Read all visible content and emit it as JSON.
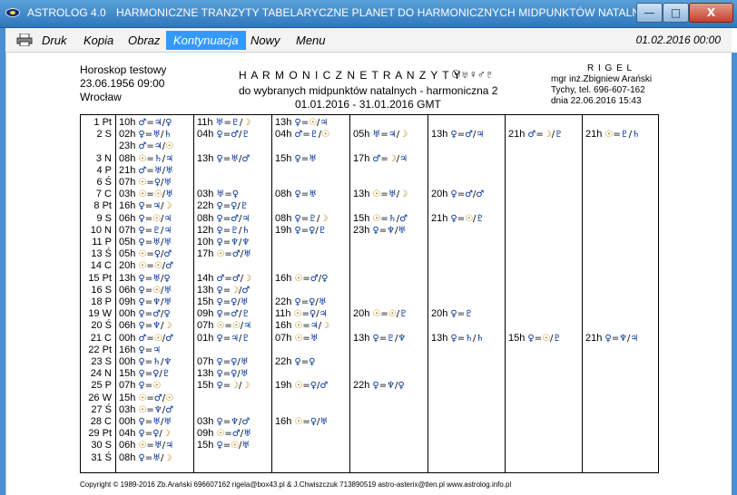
{
  "window": {
    "app_name": "ASTROLOG 4.0",
    "title": "HARMONICZNE TRANZYTY TABELARYCZNE PLANET DO HARMONICZNYCH MIDPUNKTÓW NATALNYCH",
    "minimize": "—",
    "maximize": "□",
    "close": "X"
  },
  "menu": {
    "items": [
      "Druk",
      "Kopia",
      "Obraz",
      "Kontynuacja",
      "Nowy",
      "Menu"
    ],
    "active_index": 3,
    "date": "01.02.2016  00:00"
  },
  "header": {
    "chart_name": "Horoskop testowy",
    "chart_date": "23.06.1956  09:00",
    "chart_place": "Wrocław",
    "main_title": "H A R M O N I C Z N E    T R A N Z Y T Y",
    "title_glyphs": "☉♅♀♂♇",
    "subtitle": "do wybranych midpunktów natalnych - harmoniczna 2",
    "range": "01.01.2016 - 31.01.2016  GMT",
    "rigel": "R I G E L",
    "author": "mgr inż.Zbigniew Arański",
    "phone": "Tychy, tel. 696-607-162",
    "date_line": "dnia 22.06.2016 15:43"
  },
  "table": {
    "rows": [
      {
        "day": "1 Pt",
        "cells": [
          {
            "t": "10h",
            "g": "♂=♃/♀"
          },
          {
            "t": "11h",
            "g": "♅=♇/☽"
          },
          {
            "t": "13h",
            "g": "♀=☉/♃"
          }
        ]
      },
      {
        "day": "2 S",
        "cells": [
          {
            "t": "02h",
            "g": "♀=♅/♄"
          },
          {
            "t": "04h",
            "g": "♀=♂/♇"
          },
          {
            "t": "04h",
            "g": "♂=♇/☉"
          },
          {
            "t": "05h",
            "g": "♅=♃/☽"
          },
          {
            "t": "13h",
            "g": "♀=♂/♃"
          },
          {
            "t": "21h",
            "g": "♂=☽/♇"
          },
          {
            "t": "21h",
            "g": "☉=♇/♄"
          }
        ]
      },
      {
        "day": "",
        "cells": [
          {
            "t": "23h",
            "g": "♂=♃/☉"
          }
        ]
      },
      {
        "day": "3 N",
        "cells": [
          {
            "t": "08h",
            "g": "☉=♄/♃"
          },
          {
            "t": "13h",
            "g": "♀=♅/♂"
          },
          {
            "t": "15h",
            "g": "♀=♅"
          },
          {
            "t": "17h",
            "g": "♂=☽/♃"
          }
        ]
      },
      {
        "day": "4 P",
        "cells": [
          {
            "t": "21h",
            "g": "♂=♅/♅"
          }
        ]
      },
      {
        "day": "6 Ś",
        "cells": [
          {
            "t": "07h",
            "g": "☉=♀/♅"
          }
        ]
      },
      {
        "day": "7 C",
        "cells": [
          {
            "t": "03h",
            "g": "☉=☉/♅"
          },
          {
            "t": "03h",
            "g": "♅=♀"
          },
          {
            "t": "08h",
            "g": "♀=♅"
          },
          {
            "t": "13h",
            "g": "☉=♅/☽"
          },
          {
            "t": "20h",
            "g": "♀=♂/♂"
          }
        ]
      },
      {
        "day": "8 Pt",
        "cells": [
          {
            "t": "16h",
            "g": "♀=♃/☽"
          },
          {
            "t": "22h",
            "g": "♀=♀/♇"
          }
        ]
      },
      {
        "day": "9 S",
        "cells": [
          {
            "t": "06h",
            "g": "♀=☉/♃"
          },
          {
            "t": "08h",
            "g": "♀=♂/♃"
          },
          {
            "t": "08h",
            "g": "♀=♇/☽"
          },
          {
            "t": "15h",
            "g": "☉=♄/♂"
          },
          {
            "t": "21h",
            "g": "♀=☉/♇"
          }
        ]
      },
      {
        "day": "10 N",
        "cells": [
          {
            "t": "07h",
            "g": "♀=♇/♃"
          },
          {
            "t": "12h",
            "g": "♀=♇/♄"
          },
          {
            "t": "19h",
            "g": "♀=♀/♇"
          },
          {
            "t": "23h",
            "g": "♀=♆/♅"
          }
        ]
      },
      {
        "day": "11 P",
        "cells": [
          {
            "t": "05h",
            "g": "♀=♅/♅"
          },
          {
            "t": "10h",
            "g": "♀=♆/♆"
          }
        ]
      },
      {
        "day": "13 Ś",
        "cells": [
          {
            "t": "05h",
            "g": "☉=♀/♂"
          },
          {
            "t": "17h",
            "g": "☉=♂/♅"
          }
        ]
      },
      {
        "day": "14 C",
        "cells": [
          {
            "t": "20h",
            "g": "☉=☉/♂"
          }
        ]
      },
      {
        "day": "15 Pt",
        "cells": [
          {
            "t": "13h",
            "g": "♀=♅/♀"
          },
          {
            "t": "14h",
            "g": "♂=♂/☽"
          },
          {
            "t": "16h",
            "g": "☉=♂/♀"
          }
        ]
      },
      {
        "day": "16 S",
        "cells": [
          {
            "t": "06h",
            "g": "♀=☉/♅"
          },
          {
            "t": "13h",
            "g": "♀=☽/♂"
          }
        ]
      },
      {
        "day": "18 P",
        "cells": [
          {
            "t": "09h",
            "g": "♀=♆/♅"
          },
          {
            "t": "15h",
            "g": "♀=♀/♅"
          },
          {
            "t": "22h",
            "g": "♀=♀/♅"
          }
        ]
      },
      {
        "day": "19 W",
        "cells": [
          {
            "t": "00h",
            "g": "♀=♂/♀"
          },
          {
            "t": "09h",
            "g": "♀=♂/♇"
          },
          {
            "t": "11h",
            "g": "☉=♀/♃"
          },
          {
            "t": "20h",
            "g": "☉=☉/♇"
          },
          {
            "t": "20h",
            "g": "♀=♇"
          }
        ]
      },
      {
        "day": "20 Ś",
        "cells": [
          {
            "t": "06h",
            "g": "♀=♆/☽"
          },
          {
            "t": "07h",
            "g": "☉=☉/♃"
          },
          {
            "t": "16h",
            "g": "☉=♃/☽"
          }
        ]
      },
      {
        "day": "21 C",
        "cells": [
          {
            "t": "00h",
            "g": "♂=☉/♂"
          },
          {
            "t": "01h",
            "g": "♀=♃/♇"
          },
          {
            "t": "07h",
            "g": "☉=♅"
          },
          {
            "t": "13h",
            "g": "♀=♇/♆"
          },
          {
            "t": "13h",
            "g": "♀=♄/♄"
          },
          {
            "t": "15h",
            "g": "♀=☉/♇"
          },
          {
            "t": "21h",
            "g": "♀=♆/♃"
          }
        ]
      },
      {
        "day": "22 Pt",
        "cells": [
          {
            "t": "16h",
            "g": "♀=♃"
          }
        ]
      },
      {
        "day": "23 S",
        "cells": [
          {
            "t": "00h",
            "g": "♀=♄/♆"
          },
          {
            "t": "07h",
            "g": "♀=♀/♅"
          },
          {
            "t": "22h",
            "g": "♀=♀"
          }
        ]
      },
      {
        "day": "24 N",
        "cells": [
          {
            "t": "15h",
            "g": "♀=♀/♇"
          },
          {
            "t": "13h",
            "g": "♀=♀/♅"
          }
        ]
      },
      {
        "day": "25 P",
        "cells": [
          {
            "t": "07h",
            "g": "♀=☉"
          },
          {
            "t": "15h",
            "g": "♀=☽/☽"
          },
          {
            "t": "19h",
            "g": "☉=♀/♂"
          },
          {
            "t": "22h",
            "g": "♀=♆/♀"
          }
        ]
      },
      {
        "day": "26 W",
        "cells": [
          {
            "t": "15h",
            "g": "☉=♂/☉"
          }
        ]
      },
      {
        "day": "27 Ś",
        "cells": [
          {
            "t": "03h",
            "g": "☉=♆/♂"
          }
        ]
      },
      {
        "day": "28 C",
        "cells": [
          {
            "t": "00h",
            "g": "♀=♅/♅"
          },
          {
            "t": "03h",
            "g": "♀=♆/♂"
          },
          {
            "t": "16h",
            "g": "☉=♀/♅"
          }
        ]
      },
      {
        "day": "29 Pt",
        "cells": [
          {
            "t": "04h",
            "g": "♀=♀/☽"
          },
          {
            "t": "09h",
            "g": "☉=♂/♅"
          }
        ]
      },
      {
        "day": "30 S",
        "cells": [
          {
            "t": "06h",
            "g": "☉=♅/♃"
          },
          {
            "t": "15h",
            "g": "♀=☉/♅"
          }
        ]
      },
      {
        "day": "31 Ś",
        "cells": [
          {
            "t": "08h",
            "g": "♀=♅/☽"
          }
        ]
      }
    ]
  },
  "footer": "Copyright © 1989-2016 Zb.Arański 696607162 rigela@box43.pl & J.Chwiszczuk 713890519 astro-asterix@tlen.pl www.astrolog.info.pl"
}
